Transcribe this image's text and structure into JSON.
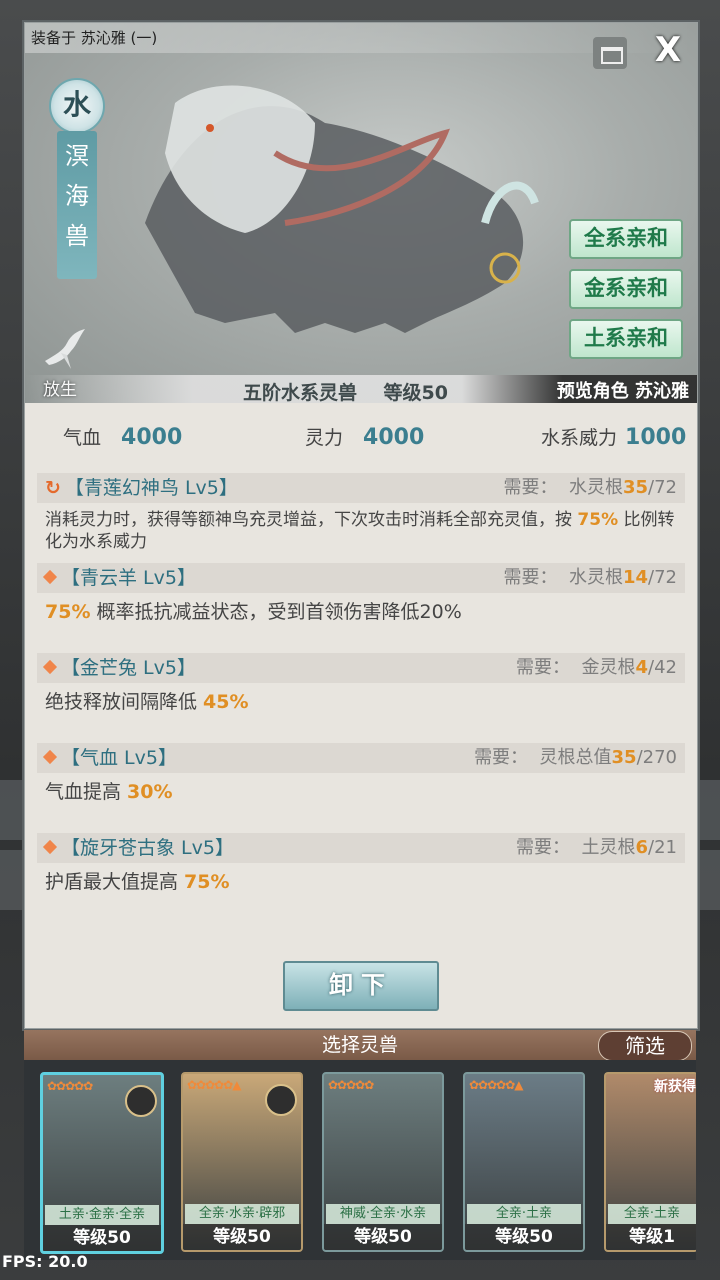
{
  "equip_bar": "装备于 苏沁雅 (一)",
  "close_label": "X",
  "element": "水",
  "beast_name_chars": [
    "溟",
    "海",
    "兽"
  ],
  "release_label": "放生",
  "affinities": [
    "全系亲和",
    "金系亲和",
    "土系亲和"
  ],
  "grade_label": "五阶水系灵兽",
  "level_label": "等级50",
  "preview_label": "预览角色 苏沁雅",
  "stats": {
    "hp_label": "气血",
    "hp_value": "4000",
    "sp_label": "灵力",
    "sp_value": "4000",
    "power_label": "水系威力",
    "power_value": "1000"
  },
  "skills": [
    {
      "name": "【青莲幻神鸟 Lv5】",
      "req_label": "需要：",
      "req_attr": "水灵根",
      "req_cur": "35",
      "req_max": "/72",
      "desc_pre": "消耗灵力时，获得等额神鸟充灵增益，下次攻击时消耗全部充灵值，按 ",
      "desc_hl": "75%",
      "desc_post": " 比例转化为水系威力"
    },
    {
      "name": "【青云羊 Lv5】",
      "req_label": "需要：",
      "req_attr": "水灵根",
      "req_cur": "14",
      "req_max": "/72",
      "desc_pre": "",
      "desc_hl": "75%",
      "desc_post": " 概率抵抗减益状态，受到首领伤害降低20%"
    },
    {
      "name": "【金芒兔 Lv5】",
      "req_label": "需要：",
      "req_attr": "金灵根",
      "req_cur": "4",
      "req_max": "/42",
      "desc_pre": "绝技释放间隔降低 ",
      "desc_hl": "45%",
      "desc_post": ""
    },
    {
      "name": "【气血 Lv5】",
      "req_label": "需要：",
      "req_attr": "灵根总值",
      "req_cur": "35",
      "req_max": "/270",
      "desc_pre": "气血提高 ",
      "desc_hl": "30%",
      "desc_post": ""
    },
    {
      "name": "【旋牙苍古象 Lv5】",
      "req_label": "需要：",
      "req_attr": "土灵根",
      "req_cur": "6",
      "req_max": "/21",
      "desc_pre": "护盾最大值提高 ",
      "desc_hl": "75%",
      "desc_post": ""
    }
  ],
  "unload_label": "卸下",
  "select_title": "选择灵兽",
  "filter_label": "筛选",
  "cards": [
    {
      "stars": "✿✿✿✿✿",
      "tags": "土亲·金亲·全亲",
      "level": "等级50",
      "bg": "#6d7e7f"
    },
    {
      "stars": "✿✿✿✿✿▲",
      "tags": "全亲·水亲·辟邪",
      "level": "等级50",
      "bg": "#c9a878"
    },
    {
      "stars": "✿✿✿✿✿",
      "tags": "神威·全亲·水亲",
      "level": "等级50",
      "bg": "#6d7e7f"
    },
    {
      "stars": "✿✿✿✿✿▲",
      "tags": "全亲·土亲",
      "level": "等级50",
      "bg": "#6b7c86"
    },
    {
      "stars": "",
      "tags": "全亲·土亲",
      "level": "等级1",
      "bg": "#b08a6a",
      "new": "新获得"
    }
  ],
  "fps": "FPS: 20.0"
}
